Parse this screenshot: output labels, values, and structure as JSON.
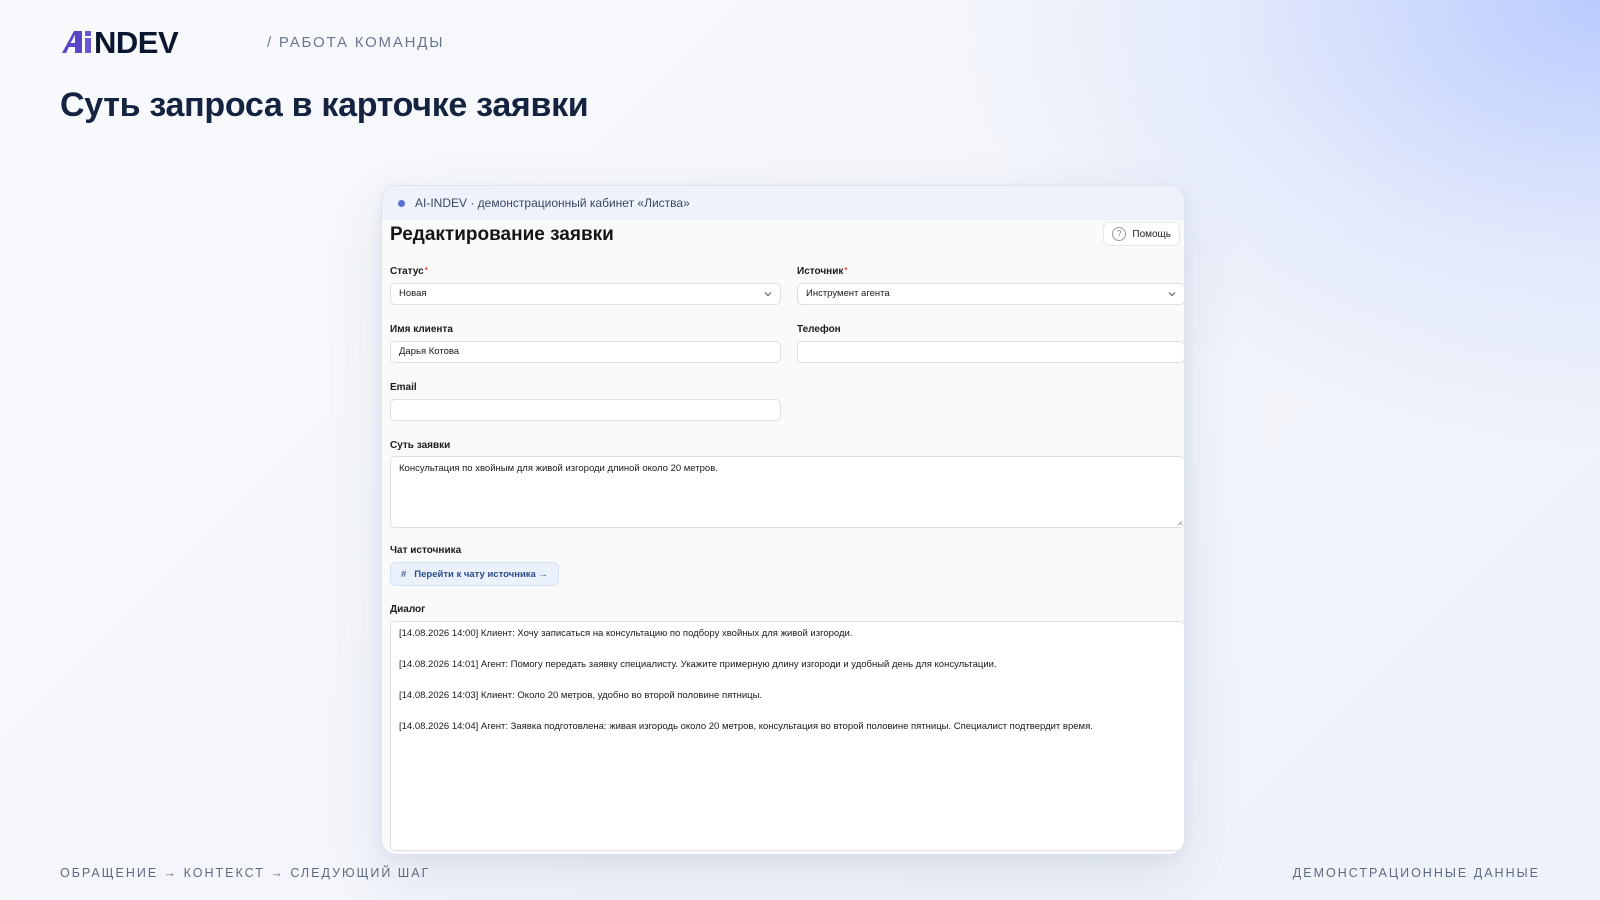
{
  "header": {
    "logo": {
      "accent": "Ai",
      "main": "NDEV"
    },
    "section": "/ РАБОТА КОМАНДЫ",
    "title": "Суть запроса в карточке заявки"
  },
  "window": {
    "bar_title": "AI-INDEV · демонстрационный кабинет «Листва»"
  },
  "form": {
    "title": "Редактирование заявки",
    "help_label": "Помощь",
    "status": {
      "label": "Статус",
      "required_mark": "*",
      "value": "Новая"
    },
    "source": {
      "label": "Источник",
      "required_mark": "*",
      "value": "Инструмент агента"
    },
    "client_name": {
      "label": "Имя клиента",
      "value": "Дарья Котова"
    },
    "phone": {
      "label": "Телефон",
      "value": ""
    },
    "email": {
      "label": "Email",
      "value": ""
    },
    "summary": {
      "label": "Суть заявки",
      "value": "Консультация по хвойным для живой изгороди длиной около 20 метров."
    },
    "source_chat": {
      "label": "Чат источника",
      "button_icon": "#",
      "button_label": "Перейти к чату источника →"
    },
    "dialog": {
      "label": "Диалог",
      "lines": [
        "[14.08.2026 14:00] Клиент: Хочу записаться на консультацию по подбору хвойных для живой изгороди.",
        "[14.08.2026 14:01] Агент: Помогу передать заявку специалисту. Укажите примерную длину изгороди и удобный день для консультации.",
        "[14.08.2026 14:03] Клиент: Около 20 метров, удобно во второй половине пятницы.",
        "[14.08.2026 14:04] Агент: Заявка подготовлена: живая изгородь около 20 метров, консультация во второй половине пятницы. Специалист подтвердит время."
      ]
    }
  },
  "footer": {
    "left": "ОБРАЩЕНИЕ → КОНТЕКСТ → СЛЕДУЮЩИЙ ШАГ",
    "right": "ДЕМОНСТРАЦИОННЫЕ ДАННЫЕ"
  },
  "colors": {
    "accent": "#6b57d6",
    "title": "#142440",
    "window_bar": "#eef2fc",
    "link_button_bg": "#eaf1fb",
    "link_button_text": "#2b4c8c",
    "required": "#e0483c"
  },
  "icons": {
    "logo_mark": "ai-logo-mark",
    "status_dot": "status-dot-icon",
    "help": "help-circle-icon",
    "dropdown": "chevron-down-icon",
    "resize": "resize-grip-icon"
  }
}
